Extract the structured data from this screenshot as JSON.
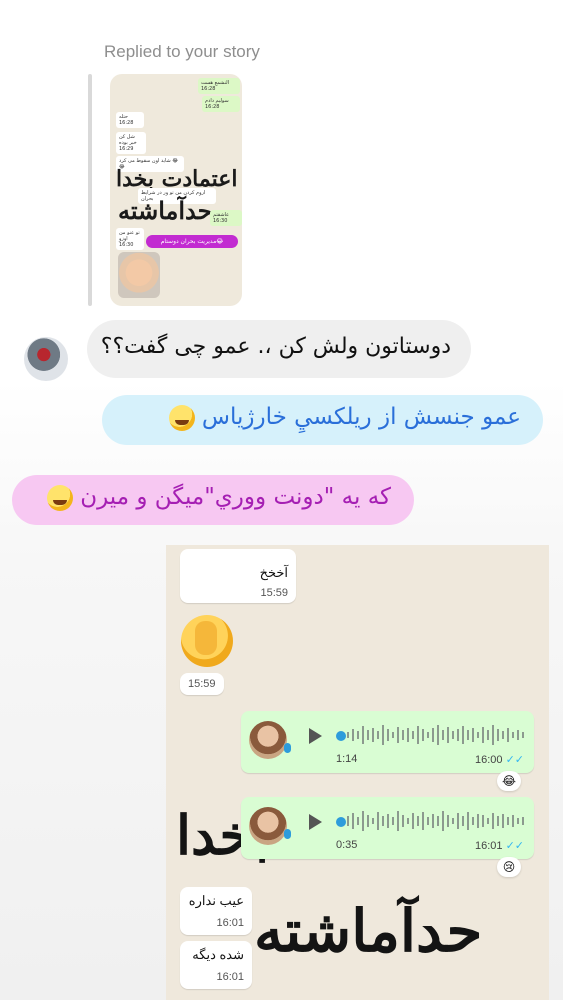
{
  "story_reply": {
    "label": "Replied to your story",
    "story": {
      "bubbles": [
        {
          "text": "النشمع هست",
          "time": "16:28"
        },
        {
          "text": "سولیم دادم",
          "time": "16:28"
        },
        {
          "text": "حتله",
          "time": "16:28"
        },
        {
          "text": "شل کن خبر بوده",
          "time": "16:29"
        },
        {
          "text": "شاید اون سقوط می کرد 😂😂",
          "time": ""
        },
        {
          "text": "اروم کردن من تو ور در شرایط بحران",
          "time": ""
        },
        {
          "text": "عاشقتم",
          "time": "16:30"
        },
        {
          "text": "تو عنو من اوزو",
          "time": "16:30"
        }
      ],
      "calligraphy_top": "اعتمادت بخدا",
      "calligraphy_bottom": "حدآماشته",
      "pill": "مدیریت بحران دوستام😂"
    }
  },
  "messages": [
    {
      "text": "دوستاتون ولش کن ،. عمو چی گفت؟؟"
    },
    {
      "text": "عمو جنسش از ريلكسيِ خارژياس"
    },
    {
      "text": "كه يه \"دونت ووري\"ميگن و ميرن"
    }
  ],
  "whatsapp": {
    "msg1": {
      "text": "آخخخ",
      "time": "15:59"
    },
    "sticker_time": "15:59",
    "voice1": {
      "duration": "1:14",
      "time": "16:00",
      "reaction": "😂"
    },
    "voice2": {
      "duration": "0:35",
      "time": "16:01",
      "reaction": "😢"
    },
    "msg2": {
      "text": "عیب نداره",
      "time": "16:01"
    },
    "msg3": {
      "text": "شده دیگه",
      "time": "16:01"
    },
    "bg_calligraphy_1": "عتمادت بخدا",
    "bg_calligraphy_2": "حدآماشته"
  },
  "colors": {
    "blue_bubble": "#d6f1fb",
    "blue_text": "#2a6fd9",
    "pink_bubble": "#f7c8f2",
    "pink_text": "#a51fb3",
    "whatsapp_green": "#d9fdd3"
  }
}
